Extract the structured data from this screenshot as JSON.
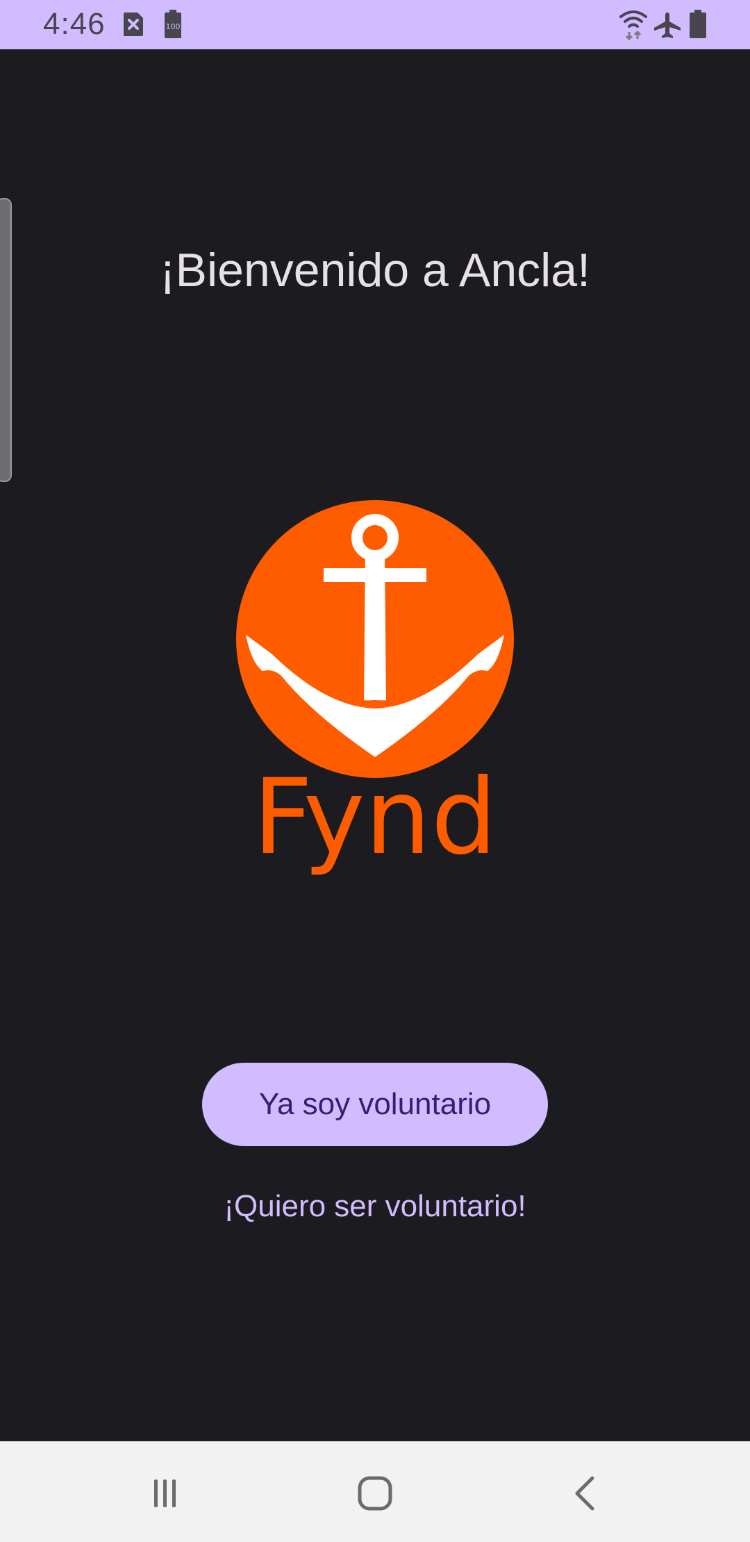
{
  "status_bar": {
    "time": "4:46",
    "icons": [
      "sim-error-icon",
      "battery-100-icon",
      "wifi-icon",
      "airplane-mode-icon",
      "battery-icon"
    ],
    "background": "#d0bcff"
  },
  "welcome": {
    "title": "¡Bienvenido a Ancla!"
  },
  "logo": {
    "text": "Fynd",
    "color": "#ff5c00"
  },
  "actions": {
    "primary_label": "Ya soy voluntario",
    "secondary_label": "¡Quiero ser voluntario!"
  },
  "nav_bar": {
    "items": [
      "recent-apps-icon",
      "home-icon",
      "back-icon"
    ]
  },
  "colors": {
    "background": "#1c1b20",
    "accent": "#d0bcff",
    "on_accent": "#381e72",
    "title_text": "#e6e1e5"
  }
}
